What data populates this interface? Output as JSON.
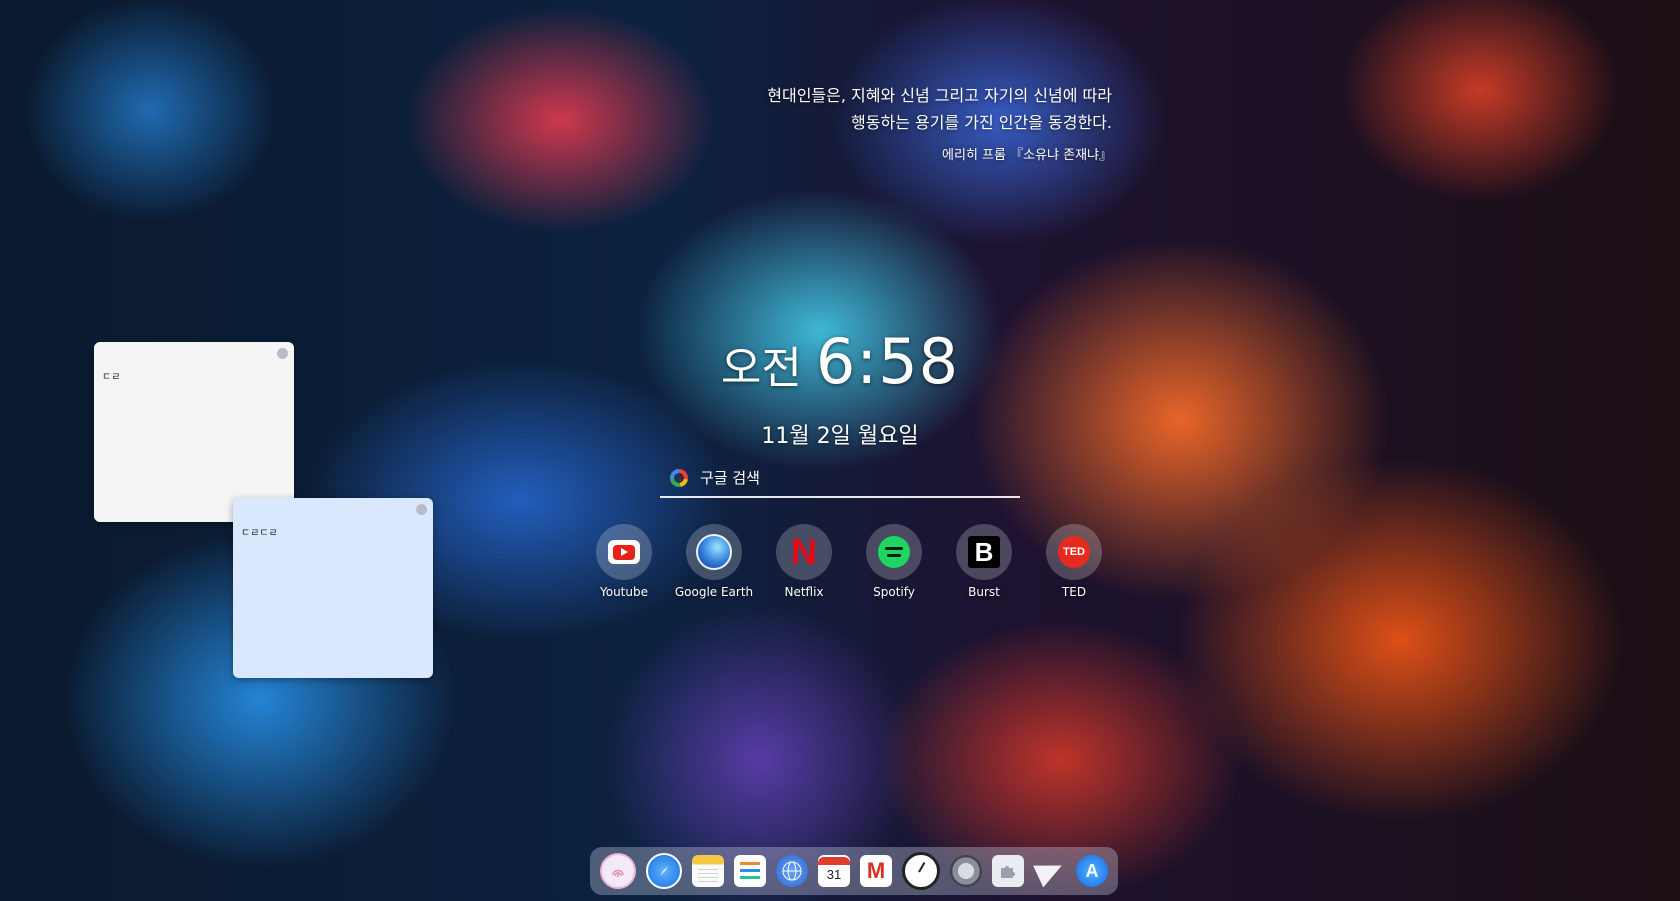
{
  "quote": {
    "lines": [
      "현대인들은, 지혜와 신념 그리고 자기의 신념에 따라",
      "행동하는 용기를 가진 인간을 동경한다."
    ],
    "attribution": "에리히 프롬 『소유냐 존재냐』"
  },
  "clock": {
    "ampm": "오전",
    "time": "6:58",
    "date": "11월 2일 월요일"
  },
  "search": {
    "placeholder": "구글 검색",
    "icon": "google-icon"
  },
  "shortcuts": [
    {
      "label": "Youtube",
      "icon": "youtube-icon"
    },
    {
      "label": "Google Earth",
      "icon": "google-earth-icon"
    },
    {
      "label": "Netflix",
      "icon": "netflix-icon",
      "glyph": "N"
    },
    {
      "label": "Spotify",
      "icon": "spotify-icon"
    },
    {
      "label": "Burst",
      "icon": "burst-icon",
      "glyph": "B"
    },
    {
      "label": "TED",
      "icon": "ted-icon",
      "glyph": "TED"
    }
  ],
  "notes": [
    {
      "text": "ㄷㄹ",
      "color": "#f5f5f5"
    },
    {
      "text": "ㄷㄹㄷㄹ",
      "color": "#d9e8fd"
    }
  ],
  "dock": {
    "items": [
      {
        "icon": "fingerprint-icon"
      },
      {
        "icon": "safari-icon"
      },
      {
        "icon": "notes-icon"
      },
      {
        "icon": "reminders-icon"
      },
      {
        "icon": "globe-icon"
      },
      {
        "icon": "calendar-icon",
        "glyph": "31"
      },
      {
        "icon": "gmail-icon",
        "glyph": "M"
      },
      {
        "icon": "clock-icon"
      },
      {
        "icon": "settings-icon"
      },
      {
        "icon": "puzzle-icon"
      },
      {
        "icon": "send-icon"
      },
      {
        "icon": "app-store-icon",
        "glyph": "A"
      }
    ]
  },
  "colors": {
    "accent_red": "#e50914",
    "spotify_green": "#1ed760",
    "ted_red": "#e62b1e",
    "search_underline": "#ffffff"
  }
}
